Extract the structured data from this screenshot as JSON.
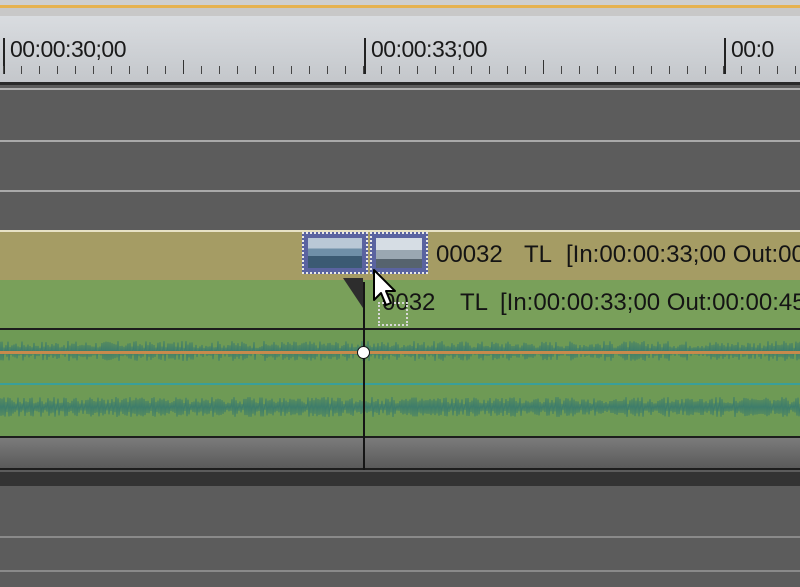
{
  "ruler": {
    "timecodes": [
      "00:00:30;00",
      "00:00:33;00",
      "00:0"
    ]
  },
  "video_clip": {
    "name": "00032",
    "track": "TL",
    "in_out": "[In:00:00:33;00 Out:00"
  },
  "audio_clip": {
    "name_partial": "0032",
    "track": "TL",
    "in_out": "[In:00:00:33;00 Out:00:00:45"
  },
  "colors": {
    "accent_line": "#e6b24f",
    "video_track": "#a59c64",
    "audio_track": "#79a05a",
    "waveform_track": "#6e9a55",
    "thumbnail_frame": "#5a63a0",
    "volume_line": "#c78a4c",
    "pan_line": "#3a9f9a"
  },
  "icons": {
    "cursor": "mouse-pointer-icon",
    "keyframe": "keyframe-point-icon"
  }
}
